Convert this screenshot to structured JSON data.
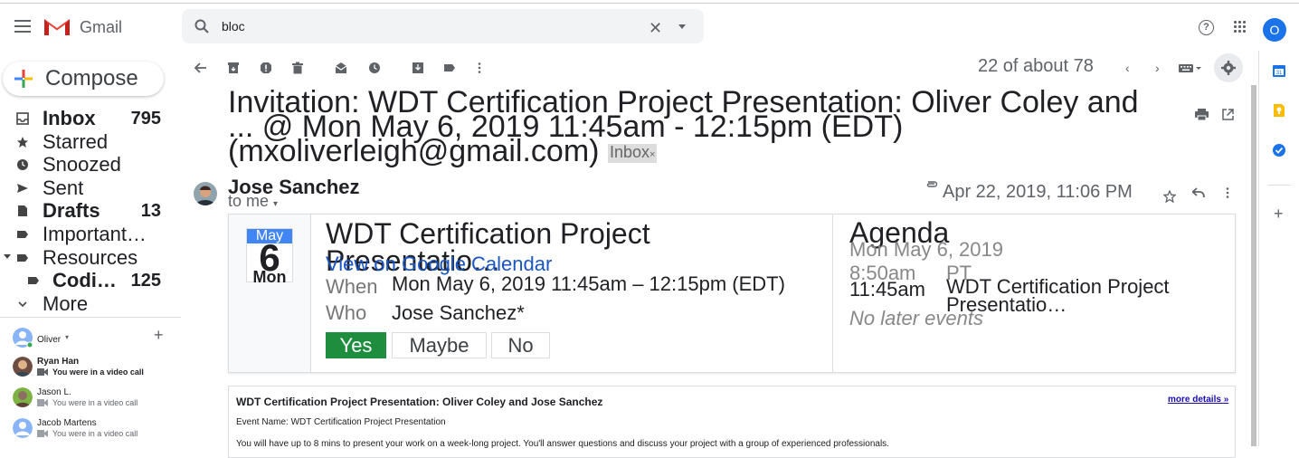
{
  "header": {
    "app_name": "Gmail",
    "search_value": "bloc",
    "account_initial": "O"
  },
  "compose_label": "Compose",
  "nav": [
    {
      "label": "Inbox",
      "count": "795",
      "bold": true,
      "icon": "inbox-icon"
    },
    {
      "label": "Starred",
      "count": "",
      "bold": false,
      "icon": "star-icon"
    },
    {
      "label": "Snoozed",
      "count": "",
      "bold": false,
      "icon": "clock-icon"
    },
    {
      "label": "Sent",
      "count": "",
      "bold": false,
      "icon": "send-icon"
    },
    {
      "label": "Drafts",
      "count": "13",
      "bold": true,
      "icon": "draft-icon"
    },
    {
      "label": "Important…",
      "count": "",
      "bold": false,
      "icon": "label-icon"
    },
    {
      "label": "Resources",
      "count": "",
      "bold": false,
      "icon": "label-icon"
    },
    {
      "label": "Codi…",
      "count": "125",
      "bold": true,
      "icon": "label-icon"
    },
    {
      "label": "More",
      "count": "",
      "bold": false,
      "icon": "chevron-down-icon"
    }
  ],
  "hangouts": {
    "user": "Oliver",
    "contacts": [
      {
        "name": "Ryan Han",
        "status": "You were in a video call",
        "bold": true
      },
      {
        "name": "Jason L.",
        "status": "You were in a video call",
        "bold": false
      },
      {
        "name": "Jacob Martens",
        "status": "You were in a video call",
        "bold": false
      }
    ]
  },
  "toolbar": {
    "pager": "22 of about 78"
  },
  "email": {
    "subject": "Invitation: WDT Certification Project Presentation: Oliver Coley and ... @ Mon May 6, 2019 11:45am - 12:15pm (EDT) (mxoliverleigh@gmail.com)",
    "label_chip": "Inbox",
    "label_chip_close": "×",
    "sender": "Jose Sanchez",
    "to": "to me",
    "date": "Apr 22, 2019, 11:06 PM"
  },
  "invite": {
    "month": "May",
    "day": "6",
    "weekday": "Mon",
    "title": "WDT Certification Project Presentatio…",
    "gcal_link": "View on Google Calendar",
    "when_label": "When",
    "when_value": "Mon May 6, 2019 11:45am – 12:15pm (EDT)",
    "who_label": "Who",
    "who_value": "Jose Sanchez*",
    "rsvp_yes": "Yes",
    "rsvp_maybe": "Maybe",
    "rsvp_no": "No"
  },
  "agenda": {
    "title": "Agenda",
    "date": "Mon May 6, 2019",
    "earlier_time": "8:50am",
    "earlier_tz": "PT",
    "time": "11:45am",
    "event": "WDT Certification Project Presentatio…",
    "none": "No later events"
  },
  "body": {
    "title": "WDT Certification Project Presentation: Oliver Coley and Jose Sanchez",
    "more_details": "more details »",
    "event_name": "Event Name: WDT Certification Project Presentation",
    "paragraph": "You will have up to 8 mins to present your work on a week-long project. You'll answer questions and discuss your project with a group of experienced professionals."
  },
  "colors": {
    "accent_blue": "#1a73e8",
    "rsvp_yes": "#1e8e3e",
    "link": "#1a55c4"
  }
}
